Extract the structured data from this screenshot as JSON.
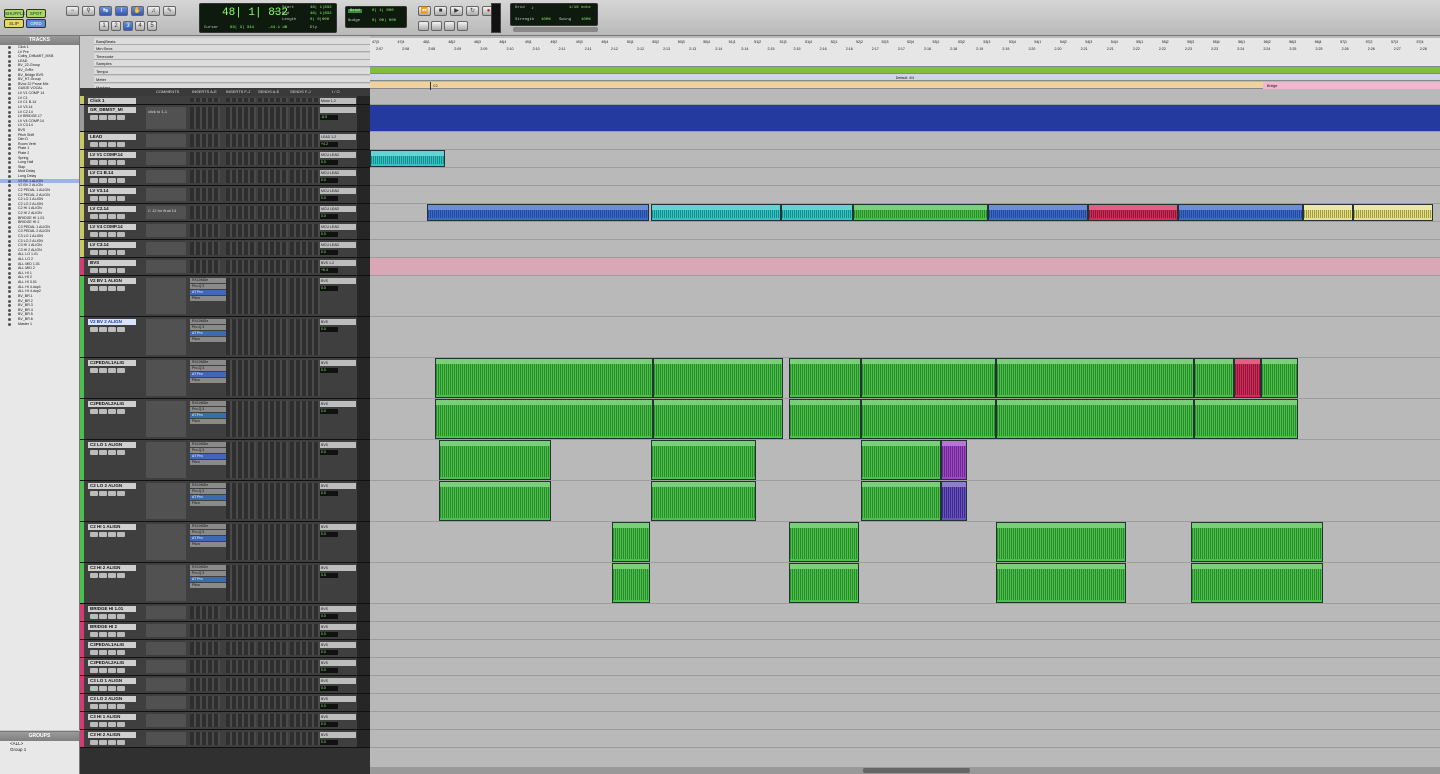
{
  "toolbar": {
    "modes": [
      "SHUFFLE",
      "SPOT",
      "SLIP",
      "GRID"
    ],
    "main_counter": "48| 1| 832",
    "counter_arrow": "-",
    "start_label": "Start",
    "end_label": "End",
    "length_label": "Length",
    "start_val": "48| 1|832",
    "end_val": "48| 1|832",
    "length_val": "0| 0|000",
    "cursor_label": "Cursor",
    "cursor_val": "63| 3| 344",
    "cursor_db": "-44.1 dB",
    "dly_label": "Dly",
    "nudge_label": "Nudge",
    "grid_label": "Grid",
    "grid_val": "0| 1| 000",
    "nudge_val": "0| 00| 000",
    "tempo_grid_label": "Grid",
    "tempo_val": "1/16 note",
    "strength_label": "Strength",
    "strength_val": "100%",
    "swing_label": "Swing",
    "swing_val": "100%"
  },
  "tracks_panel": {
    "title": "TRACKS"
  },
  "track_list": [
    "Click 1",
    "LV Pre",
    "Colby_DrBoMIT_MXB",
    "LEAD",
    "BV_22-Group",
    "BV_GrRe",
    "BV_Bridge BVS",
    "BV_HT-Group",
    "BVox 22 Prose Mix",
    "GUIDE VOCAL",
    "LV V1 COMP 14",
    "LV C1",
    "LV C1 B.14",
    "LV V3.14",
    "LV C2.14",
    "LV BRIDGE.17",
    "LV V4 COMP.14",
    "LV C3.14",
    "BVS",
    "Pitch Shift",
    "Dim D",
    "Room Verb",
    "Plate 1",
    "Plate 2",
    "Spring",
    "Long Hall",
    "Slap",
    "Mod Delay",
    "Long Delay",
    "V2 BV 1 ALIGN",
    "V2 BV 2 ALIGN",
    "C2 PEDAL 1 ALIGN",
    "C2 PEDAL 2 ALIGN",
    "C2 LO 1 ALIGN",
    "C2 LO 2 ALIGN",
    "C2 HI 1 ALIGN",
    "C2 HI 2 ALIGN",
    "BRIDGE HI 1.01",
    "BRIDGE HI 2",
    "C3 PEDAL 1 ALIGN",
    "C3 PEDAL 2 ALIGN",
    "C3 LO 1 ALIGN",
    "C3 LO 2 ALIGN",
    "C3 HI 1 ALIGN",
    "C3 HI 2 ALIGN",
    "ALL LO 1.01",
    "ALL LO 2",
    "ALL MID 1.01",
    "ALL MID 2",
    "ALL HI 1",
    "ALL HI 2",
    "ALL HI 3.01",
    "ALL HI 4.dup1",
    "ALL HI 4.dup2",
    "BV_BR.1",
    "BV_BR.2",
    "BV_BR.3",
    "BV_BR.4",
    "BV_BR.5",
    "BV_BR.6",
    "Master 1"
  ],
  "groups_panel": {
    "title": "GROUPS",
    "items": [
      "<ALL>",
      "Group 1"
    ]
  },
  "rulers": [
    "Bars|Beats",
    "Min:Secs",
    "Timecode",
    "Samples",
    "Tempo",
    "Meter",
    "Markers"
  ],
  "bars": [
    "47|3",
    "47|4",
    "48|1",
    "48|2",
    "48|3",
    "48|4",
    "49|1",
    "49|2",
    "49|3",
    "49|4",
    "50|1",
    "50|2",
    "50|3",
    "50|4",
    "51|1",
    "51|2",
    "51|3",
    "51|4",
    "52|1",
    "52|2",
    "52|3",
    "52|4",
    "53|1",
    "53|2",
    "53|3",
    "53|4",
    "54|1",
    "54|2",
    "54|3",
    "54|4",
    "55|1",
    "55|2",
    "55|3",
    "55|4",
    "56|1",
    "56|2",
    "56|3",
    "56|4",
    "57|1",
    "57|2",
    "57|3",
    "57|4"
  ],
  "minsecs": [
    "2:07",
    "2:08",
    "2:08",
    "2:09",
    "2:09",
    "2:10",
    "2:10",
    "2:11",
    "2:11",
    "2:12",
    "2:12",
    "2:13",
    "2:13",
    "2:14",
    "2:14",
    "2:15",
    "2:15",
    "2:16",
    "2:16",
    "2:17",
    "2:17",
    "2:18",
    "2:18",
    "2:19",
    "2:19",
    "2:20",
    "2:20",
    "2:21",
    "2:21",
    "2:22",
    "2:22",
    "2:23",
    "2:23",
    "2:24",
    "2:24",
    "2:25",
    "2:25",
    "2:26",
    "2:26",
    "2:27",
    "2:28"
  ],
  "meter_label": "Default: 4/4",
  "markers": [
    {
      "name": "C2"
    },
    {
      "name": "Bridge"
    }
  ],
  "col_headers": [
    "COMMENTS",
    "INSERTS A-E",
    "INSERTS F-J",
    "SENDS A-E",
    "SENDS F-J",
    "I / O"
  ],
  "edit_tracks": [
    {
      "name": "Click 1",
      "comment": "",
      "io": "Mono 1-2",
      "vol": "-3.0",
      "color": "#c8c864"
    },
    {
      "name": "GR_DBMST_MI",
      "comment": "click to 1-1",
      "io": "",
      "vol": "-6.5",
      "color": "#9a9a9a"
    },
    {
      "name": "LEAD",
      "comment": "",
      "io": "LEAD 1-2",
      "vol": "+4.2",
      "color": "#c8c864"
    },
    {
      "name": "LV V1 COMP.14",
      "comment": "",
      "io": "MCU LEAD",
      "vol": "0.0",
      "color": "#c8c864"
    },
    {
      "name": "LV C1 B.14",
      "comment": "",
      "io": "MCU LEAD",
      "vol": "0.0",
      "color": "#c8c864"
    },
    {
      "name": "LV V3.14",
      "comment": "",
      "io": "MCU LEAD",
      "vol": "0.0",
      "color": "#c8c864"
    },
    {
      "name": "LV C2.14",
      "comment": "C 12 for final 14",
      "io": "MCU LEAD",
      "vol": "0.0",
      "color": "#c8c864"
    },
    {
      "name": "LV V4 COMP.14",
      "comment": "",
      "io": "MCU LEAD",
      "vol": "0.0",
      "color": "#c8c864"
    },
    {
      "name": "LV C3.14",
      "comment": "",
      "io": "MCU LEAD",
      "vol": "0.0",
      "color": "#c8c864"
    },
    {
      "name": "BVS",
      "comment": "",
      "io": "BVS 1-2",
      "vol": "+6.4",
      "color": "#d63a72"
    },
    {
      "name": "V2 BV 1 ALIGN",
      "comment": "",
      "io": "BVS",
      "vol": "0.0",
      "color": "#4cc04c"
    },
    {
      "name": "V2 BV 2 ALIGN",
      "comment": "",
      "io": "BVS",
      "vol": "0.0",
      "color": "#4cc04c"
    },
    {
      "name": "C2PEDAL1ALIG",
      "comment": "",
      "io": "BVS",
      "vol": "0.0",
      "color": "#4cc04c"
    },
    {
      "name": "C2PEDAL2ALIG",
      "comment": "",
      "io": "BVS",
      "vol": "0.0",
      "color": "#4cc04c"
    },
    {
      "name": "C2 LO 1 ALIGN",
      "comment": "",
      "io": "BVS",
      "vol": "0.0",
      "color": "#4cc04c"
    },
    {
      "name": "C2 LO 2 ALIGN",
      "comment": "",
      "io": "BVS",
      "vol": "0.0",
      "color": "#4cc04c"
    },
    {
      "name": "C2 HI 1 ALIGN",
      "comment": "",
      "io": "BVS",
      "vol": "0.0",
      "color": "#4cc04c"
    },
    {
      "name": "C2 HI 2 ALIGN",
      "comment": "",
      "io": "BVS",
      "vol": "0.0",
      "color": "#4cc04c"
    },
    {
      "name": "BRIDGE HI 1.01",
      "comment": "",
      "io": "BVS",
      "vol": "0.0",
      "color": "#d63a72"
    },
    {
      "name": "BRIDGE HI 2",
      "comment": "",
      "io": "BVS",
      "vol": "0.0",
      "color": "#d63a72"
    },
    {
      "name": "C3PEDAL1ALIG",
      "comment": "",
      "io": "BVS",
      "vol": "0.0",
      "color": "#d63a72"
    },
    {
      "name": "C3PEDAL2ALIG",
      "comment": "",
      "io": "BVS",
      "vol": "0.0",
      "color": "#d63a72"
    },
    {
      "name": "C3 LO 1 ALIGN",
      "comment": "",
      "io": "BVS",
      "vol": "0.0",
      "color": "#d63a72"
    },
    {
      "name": "C3 LO 2 ALIGN",
      "comment": "",
      "io": "BVS",
      "vol": "0.0",
      "color": "#d63a72"
    },
    {
      "name": "C3 HI 1 ALIGN",
      "comment": "",
      "io": "BVS",
      "vol": "0.0",
      "color": "#d63a72"
    },
    {
      "name": "C3 HI 2 ALIGN",
      "comment": "",
      "io": "BVS",
      "vol": "0.0",
      "color": "#d63a72"
    }
  ],
  "plugins": [
    "RX10MDe",
    "Pro-Q 3",
    "AT Pro",
    "Pitcn"
  ],
  "colors": {
    "blue": "#3d69c9",
    "cyan": "#30c4c4",
    "green": "#4cc04c",
    "red": "#d8285a",
    "yellow": "#e6e08a",
    "purple": "#a046c8",
    "violet": "#6a52c0"
  }
}
